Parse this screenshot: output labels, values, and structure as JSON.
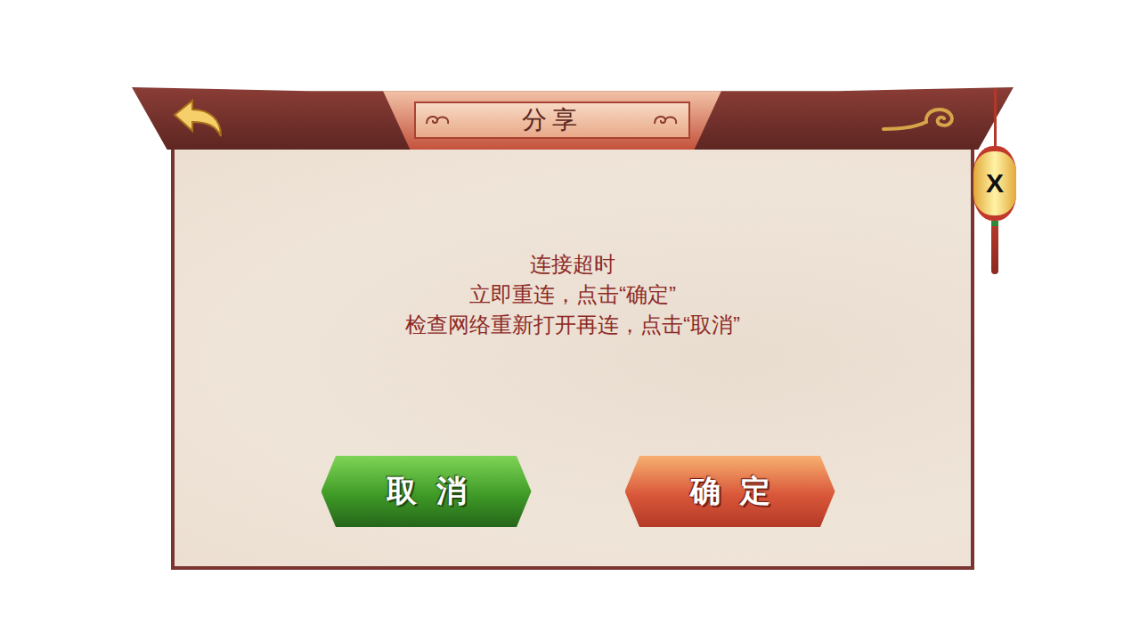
{
  "dialog": {
    "title": "分享",
    "message": [
      "连接超时",
      "立即重连，点击“确定”",
      "检查网络重新打开再连，点击“取消”"
    ],
    "close_label": "X",
    "buttons": [
      {
        "label": "取消",
        "kind": "cancel"
      },
      {
        "label": "确定",
        "kind": "confirm"
      }
    ]
  }
}
